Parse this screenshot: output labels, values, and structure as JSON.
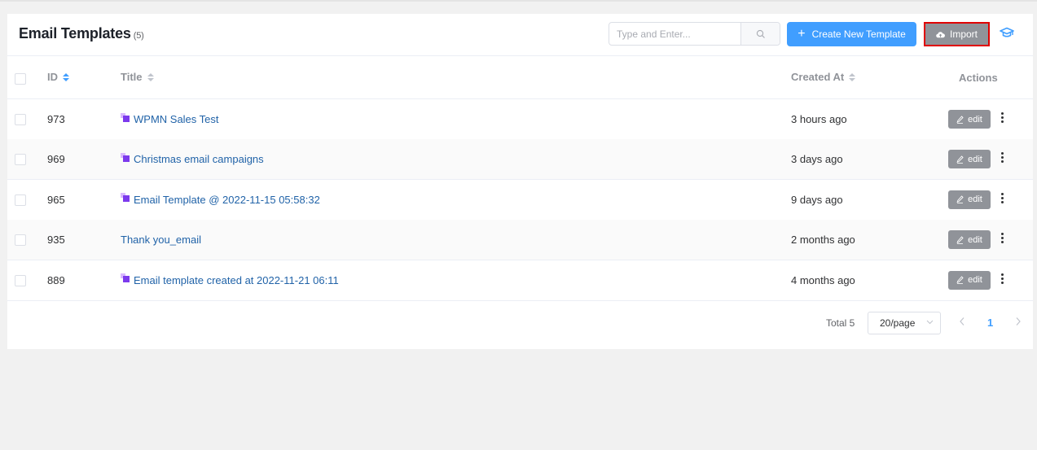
{
  "header": {
    "title": "Email Templates",
    "count": "(5)",
    "search_placeholder": "Type and Enter...",
    "create_label": "Create New Template",
    "import_label": "Import"
  },
  "table": {
    "columns": {
      "id": "ID",
      "title": "Title",
      "created_at": "Created At",
      "actions": "Actions"
    },
    "rows": [
      {
        "id": "973",
        "title": "WPMN Sales Test",
        "created": "3 hours ago",
        "has_icon": true
      },
      {
        "id": "969",
        "title": "Christmas email campaigns",
        "created": "3 days ago",
        "has_icon": true
      },
      {
        "id": "965",
        "title": "Email Template @ 2022-11-15 05:58:32",
        "created": "9 days ago",
        "has_icon": true
      },
      {
        "id": "935",
        "title": "Thank you_email",
        "created": "2 months ago",
        "has_icon": false
      },
      {
        "id": "889",
        "title": "Email template created at 2022-11-21 06:11",
        "created": "4 months ago",
        "has_icon": true
      }
    ],
    "edit_label": "edit"
  },
  "pagination": {
    "total": "Total 5",
    "page_size": "20/page",
    "current_page": "1"
  },
  "colors": {
    "primary": "#409eff",
    "import_highlight": "#e00000",
    "link": "#2163a8"
  },
  "icons": [
    "search-icon",
    "plus-icon",
    "cloud-upload-icon",
    "graduation-cap-icon",
    "pencil-icon",
    "more-vertical-icon",
    "chevron-down-icon",
    "chevron-left-icon",
    "chevron-right-icon",
    "visual-builder-icon"
  ]
}
